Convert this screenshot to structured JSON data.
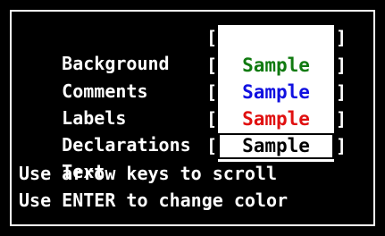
{
  "rows": [
    {
      "label": "Background",
      "sample": "",
      "color": "#ffffff"
    },
    {
      "label": "Comments",
      "sample": "Sample",
      "color": "#107a10"
    },
    {
      "label": "Labels",
      "sample": "Sample",
      "color": "#1010e0"
    },
    {
      "label": "Declarations",
      "sample": "Sample",
      "color": "#e01010"
    },
    {
      "label": "Text",
      "sample": "Sample",
      "color": "#000000"
    }
  ],
  "bracket_open": "[",
  "bracket_close": "]",
  "hints": [
    "Use arrow keys to scroll",
    "Use ENTER to change color"
  ],
  "colors": {
    "background": "#000000",
    "foreground": "#ffffff",
    "swatch_background": "#ffffff"
  }
}
